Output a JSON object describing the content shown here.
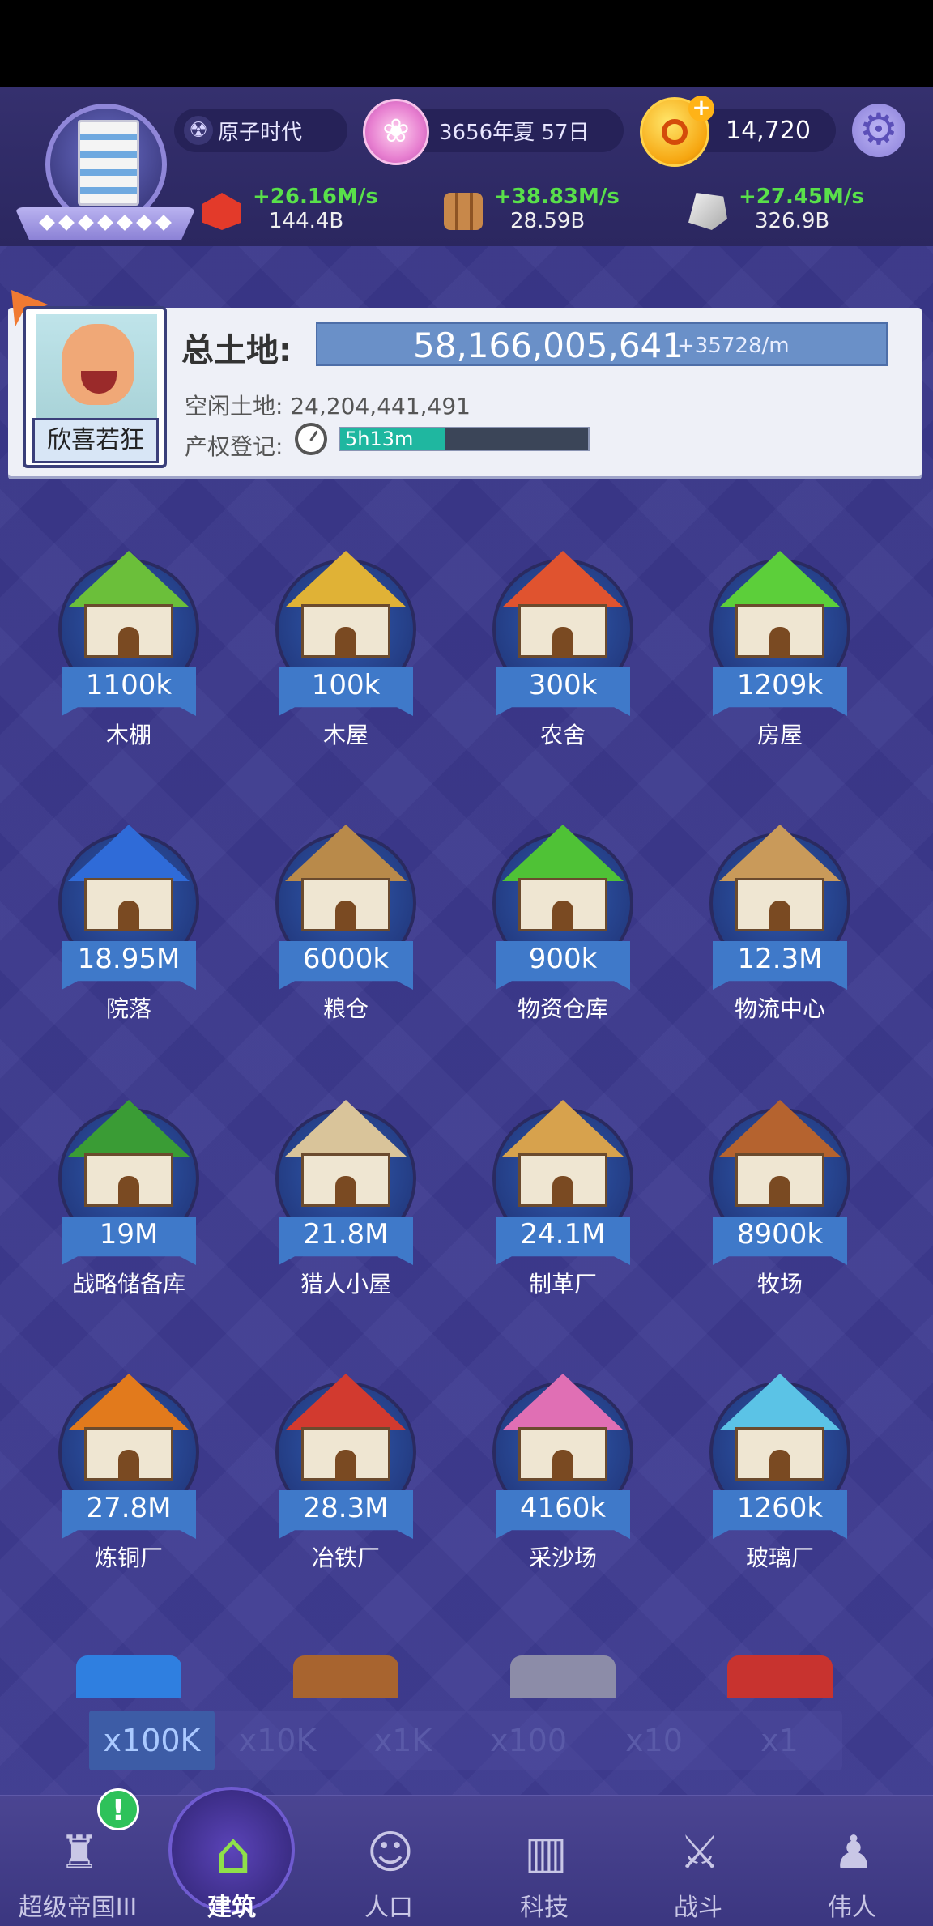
{
  "header": {
    "era": "原子时代",
    "date": "3656年夏 57日",
    "coins": "14,720",
    "resources": [
      {
        "icon": "ruby-icon",
        "rate": "+26.16M/s",
        "total": "144.4B"
      },
      {
        "icon": "wood-icon",
        "rate": "+38.83M/s",
        "total": "28.59B"
      },
      {
        "icon": "stone-icon",
        "rate": "+27.45M/s",
        "total": "326.9B"
      }
    ]
  },
  "land": {
    "total_label": "总土地:",
    "total_value": "58,166,005,641",
    "total_rate": "+35728/m",
    "idle_text": "空闲土地: 24,204,441,491",
    "register_label": "产权登记:",
    "register_timer": "5h13m",
    "register_progress": 0.42,
    "mood": "欣喜若狂"
  },
  "buildings": [
    {
      "cost": "1100k",
      "name": "木棚",
      "roof": "#6bbf3a"
    },
    {
      "cost": "100k",
      "name": "木屋",
      "roof": "#e0b236"
    },
    {
      "cost": "300k",
      "name": "农舍",
      "roof": "#e0532f"
    },
    {
      "cost": "1209k",
      "name": "房屋",
      "roof": "#5ccf3a"
    },
    {
      "cost": "18.95M",
      "name": "院落",
      "roof": "#2f6bd8"
    },
    {
      "cost": "6000k",
      "name": "粮仓",
      "roof": "#b98a4a"
    },
    {
      "cost": "900k",
      "name": "物资仓库",
      "roof": "#4fc236"
    },
    {
      "cost": "12.3M",
      "name": "物流中心",
      "roof": "#c99a5a"
    },
    {
      "cost": "19M",
      "name": "战略储备库",
      "roof": "#3a9c35"
    },
    {
      "cost": "21.8M",
      "name": "猎人小屋",
      "roof": "#d9c49a"
    },
    {
      "cost": "24.1M",
      "name": "制革厂",
      "roof": "#d7a24d"
    },
    {
      "cost": "8900k",
      "name": "牧场",
      "roof": "#b5632f"
    },
    {
      "cost": "27.8M",
      "name": "炼铜厂",
      "roof": "#e27a1c"
    },
    {
      "cost": "28.3M",
      "name": "冶铁厂",
      "roof": "#d23a2f"
    },
    {
      "cost": "4160k",
      "name": "采沙场",
      "roof": "#e06fb4"
    },
    {
      "cost": "1260k",
      "name": "玻璃厂",
      "roof": "#5bc3e6"
    }
  ],
  "multipliers": [
    "x100K",
    "x10K",
    "x1K",
    "x100",
    "x10",
    "x1"
  ],
  "active_multiplier": "x100K",
  "tabs": [
    {
      "label": "超级帝国III",
      "icon": "castle-icon"
    },
    {
      "label": "建筑",
      "icon": "house-icon"
    },
    {
      "label": "人口",
      "icon": "person-icon"
    },
    {
      "label": "科技",
      "icon": "book-icon"
    },
    {
      "label": "战斗",
      "icon": "swords-icon"
    },
    {
      "label": "伟人",
      "icon": "statue-icon"
    }
  ],
  "alert_badge": "!"
}
